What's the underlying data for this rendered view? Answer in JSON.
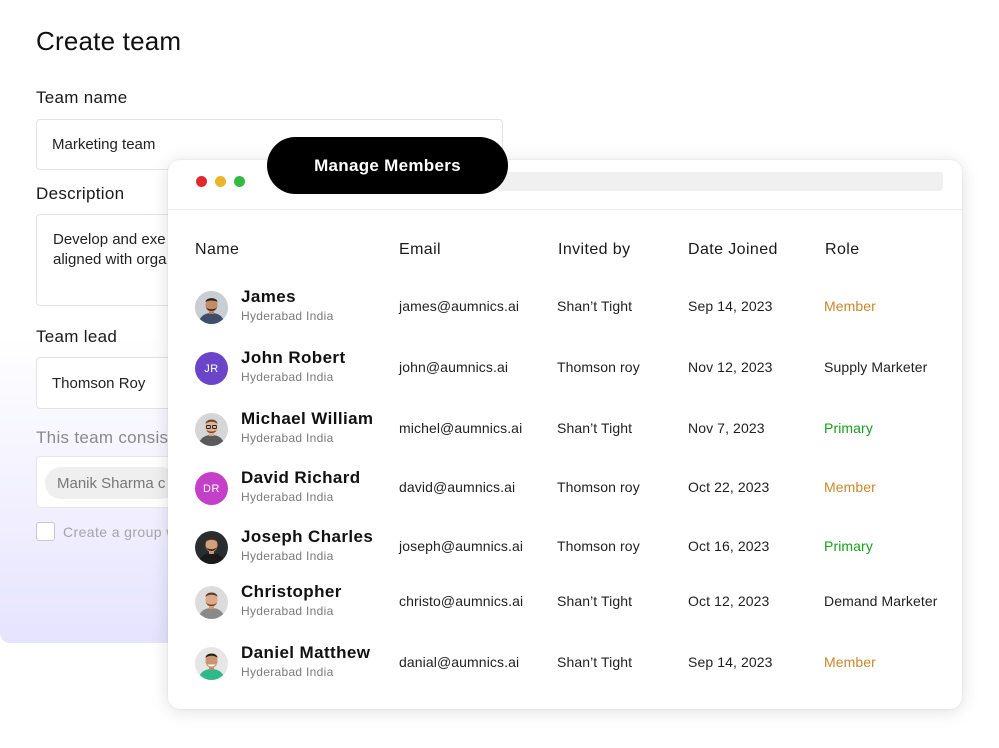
{
  "form": {
    "title": "Create team",
    "team_name_label": "Team name",
    "team_name_value": "Marketing team",
    "description_label": "Description",
    "description_line1": "Develop and exe",
    "description_line2": "aligned with orga",
    "team_lead_label": "Team lead",
    "team_lead_value": "Thomson Roy",
    "consists_label": "This team consis",
    "member_chip": "Manik Sharma c",
    "checkbox_label": "Create a group w"
  },
  "window": {
    "pill_title": "Manage Members",
    "columns": {
      "name": "Name",
      "email": "Email",
      "invited_by": "Invited by",
      "date_joined": "Date Joined",
      "role": "Role"
    },
    "members": [
      {
        "name": "James",
        "location": "Hyderabad India",
        "email": "james@aumnics.ai",
        "invited_by": "Shan’t Tight",
        "date_joined": "Sep 14, 2023",
        "role": "Member",
        "role_color": "#c9892a",
        "avatar": "photo"
      },
      {
        "name": "John Robert",
        "location": "Hyderabad India",
        "email": "john@aumnics.ai",
        "invited_by": "Thomson roy",
        "date_joined": "Nov 12, 2023",
        "role": "Supply Marketer",
        "role_color": "#1f1f1f",
        "avatar": "initials",
        "initials": "JR",
        "avatar_color": "#6a44c9"
      },
      {
        "name": "Michael William",
        "location": "Hyderabad India",
        "email": "michel@aumnics.ai",
        "invited_by": "Shan’t Tight",
        "date_joined": "Nov 7, 2023",
        "role": "Primary",
        "role_color": "#18a01c",
        "avatar": "photo"
      },
      {
        "name": "David Richard",
        "location": "Hyderabad India",
        "email": "david@aumnics.ai",
        "invited_by": "Thomson roy",
        "date_joined": "Oct 22, 2023",
        "role": "Member",
        "role_color": "#c9892a",
        "avatar": "initials",
        "initials": "DR",
        "avatar_color": "#c440c8"
      },
      {
        "name": "Joseph Charles",
        "location": "Hyderabad India",
        "email": "joseph@aumnics.ai",
        "invited_by": "Thomson roy",
        "date_joined": "Oct 16, 2023",
        "role": "Primary",
        "role_color": "#18a01c",
        "avatar": "photo"
      },
      {
        "name": "Christopher",
        "location": "Hyderabad India",
        "email": "christo@aumnics.ai",
        "invited_by": "Shan’t Tight",
        "date_joined": "Oct 12, 2023",
        "role": "Demand Marketer",
        "role_color": "#1f1f1f",
        "avatar": "photo"
      },
      {
        "name": "Daniel Matthew",
        "location": "Hyderabad India",
        "email": "danial@aumnics.ai",
        "invited_by": "Shan’t Tight",
        "date_joined": "Sep 14, 2023",
        "role": "Member",
        "role_color": "#c9892a",
        "avatar": "photo"
      }
    ]
  }
}
